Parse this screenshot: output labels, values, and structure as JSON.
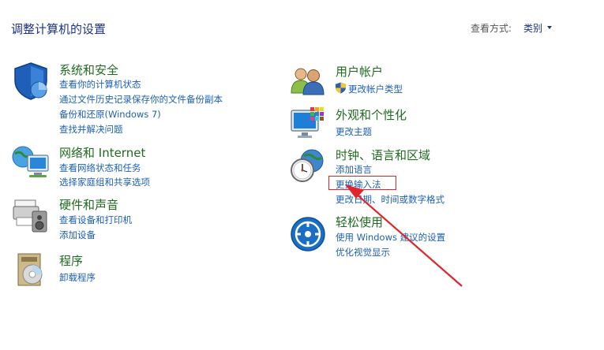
{
  "header": {
    "title": "调整计算机的设置",
    "view_by_label": "查看方式:",
    "view_by_value": "类别"
  },
  "categories": [
    {
      "title": "系统和安全",
      "icon": "security-shield-icon",
      "links": [
        "查看你的计算机状态",
        "通过文件历史记录保存你的文件备份副本",
        "备份和还原(Windows 7)",
        "查找并解决问题"
      ]
    },
    {
      "title": "网络和 Internet",
      "icon": "network-globe-icon",
      "links": [
        "查看网络状态和任务",
        "选择家庭组和共享选项"
      ]
    },
    {
      "title": "硬件和声音",
      "icon": "printer-speaker-icon",
      "links": [
        "查看设备和打印机",
        "添加设备"
      ]
    },
    {
      "title": "程序",
      "icon": "programs-disk-icon",
      "links": [
        "卸载程序"
      ]
    },
    {
      "title": "用户帐户",
      "icon": "users-icon",
      "links": [
        "更改帐户类型"
      ]
    },
    {
      "title": "外观和个性化",
      "icon": "monitor-palette-icon",
      "links": [
        "更改主题"
      ]
    },
    {
      "title": "时钟、语言和区域",
      "icon": "clock-globe-icon",
      "links": [
        "添加语言",
        "更换输入法",
        "更改日期、时间或数字格式"
      ]
    },
    {
      "title": "轻松使用",
      "icon": "ease-of-access-icon",
      "links": [
        "使用 Windows 建议的设置",
        "优化视觉显示"
      ]
    }
  ],
  "colors": {
    "category_title": "#1f6b1f",
    "link": "#1c60b3",
    "annotation": "#e0242a"
  }
}
